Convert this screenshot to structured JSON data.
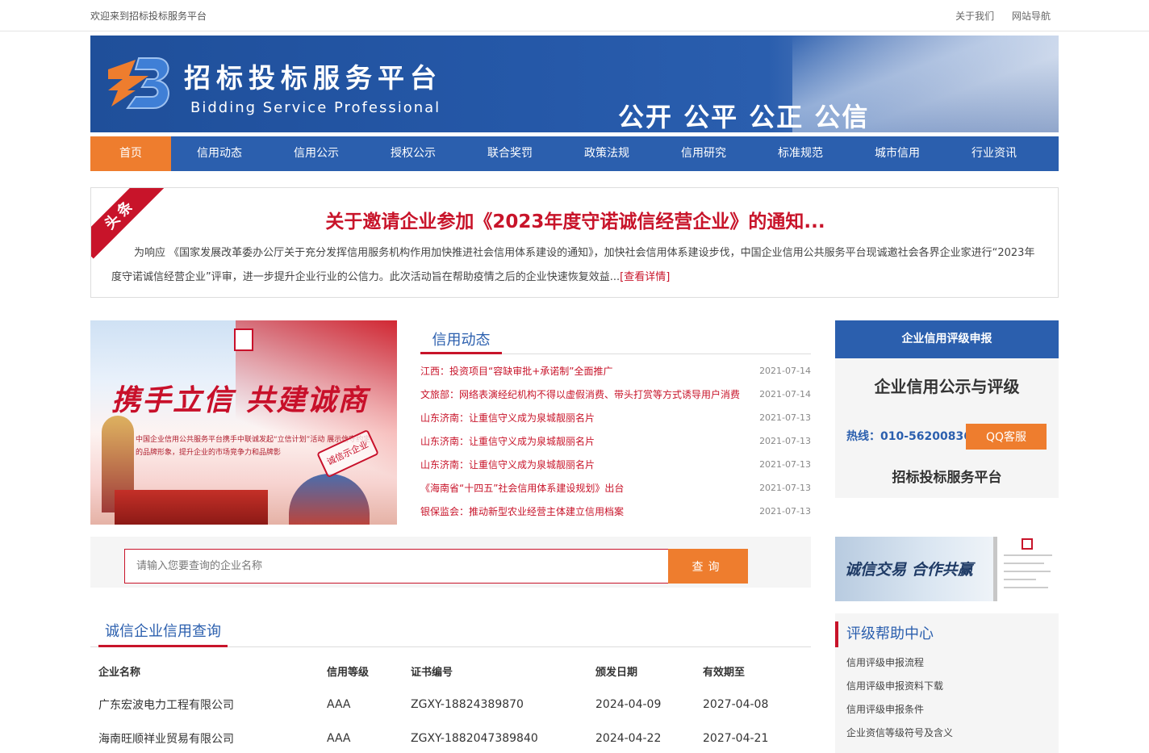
{
  "topbar": {
    "welcome": "欢迎来到招标投标服务平台",
    "about": "关于我们",
    "sitemap": "网站导航"
  },
  "banner": {
    "title": "招标投标服务平台",
    "subtitle": "Bidding Service Professional",
    "slogan": "公开 公平 公正 公信"
  },
  "nav": [
    "首页",
    "信用动态",
    "信用公示",
    "授权公示",
    "联合奖罚",
    "政策法规",
    "信用研究",
    "标准规范",
    "城市信用",
    "行业资讯"
  ],
  "headline": {
    "ribbon": "头条",
    "title": "关于邀请企业参加《2023年度守诺诚信经营企业》的通知...",
    "body": "为响应 《国家发展改革委办公厅关于充分发挥信用服务机构作用加快推进社会信用体系建设的通知》，加快社会信用体系建设步伐，中国企业信用公共服务平台现诚邀社会各界企业家进行“2023年度守诺诚信经营企业”评审，进一步提升企业行业的公信力。此次活动旨在帮助疫情之后的企业快速恢复效益...",
    "more": "[查看详情]"
  },
  "promo": {
    "slogan": "携手立信 共建诚商",
    "text": "中国企业信用公共服务平台携手中联诚发起“立信计划”活动 展示信守约定的品牌形象，提升企业的市场竞争力和品牌影",
    "seal": "诚信示企业"
  },
  "news": {
    "tab": "信用动态",
    "items": [
      {
        "title": "江西：投资项目“容缺审批+承诺制”全面推广",
        "date": "2021-07-14"
      },
      {
        "title": "文旅部：网络表演经纪机构不得以虚假消费、带头打赏等方式诱导用户消费",
        "date": "2021-07-14"
      },
      {
        "title": "山东济南：让重信守义成为泉城靓丽名片",
        "date": "2021-07-13"
      },
      {
        "title": "山东济南：让重信守义成为泉城靓丽名片",
        "date": "2021-07-13"
      },
      {
        "title": "山东济南：让重信守义成为泉城靓丽名片",
        "date": "2021-07-13"
      },
      {
        "title": "《海南省“十四五”社会信用体系建设规划》出台",
        "date": "2021-07-13"
      },
      {
        "title": "银保监会：推动新型农业经营主体建立信用档案",
        "date": "2021-07-13"
      }
    ]
  },
  "search": {
    "placeholder": "请输入您要查询的企业名称",
    "button": "查询"
  },
  "query": {
    "tab": "诚信企业信用查询",
    "columns": [
      "企业名称",
      "信用等级",
      "证书编号",
      "颁发日期",
      "有效期至"
    ],
    "rows": [
      [
        "广东宏波电力工程有限公司",
        "AAA",
        "ZGXY-18824389870",
        "2024-04-09",
        "2027-04-08"
      ],
      [
        "海南旺顺祥业贸易有限公司",
        "AAA",
        "ZGXY-1882047389840",
        "2024-04-22",
        "2027-04-21"
      ]
    ]
  },
  "side1": {
    "head": "企业信用评级申报",
    "big": "企业信用公示与评级",
    "hotline": "热线：010-56200836",
    "qq": "QQ客服",
    "platform": "招标投标服务平台"
  },
  "side2": {
    "text": "诚信交易 合作共赢"
  },
  "side3": {
    "head": "评级帮助中心",
    "items": [
      "信用评级申报流程",
      "信用评级申报资料下载",
      "信用评级申报条件",
      "企业资信等级符号及含义"
    ]
  },
  "colors": {
    "brand_blue": "#2b5fae",
    "accent_orange": "#ee7d2e",
    "alert_red": "#c8142a"
  }
}
